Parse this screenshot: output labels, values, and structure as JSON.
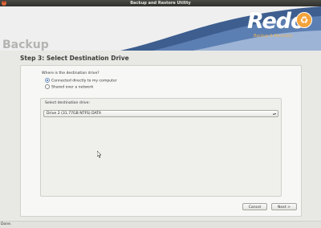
{
  "window": {
    "title": "Backup and Restore Utility"
  },
  "header": {
    "title": "Backup",
    "logo": {
      "name": "Redo",
      "tagline": "Backup & Recovery"
    }
  },
  "step": {
    "title": "Step 3: Select Destination Drive"
  },
  "question": "Where is the destination drive?",
  "options": [
    {
      "label": "Connected directly to my computer",
      "selected": true
    },
    {
      "label": "Shared over a network",
      "selected": false
    }
  ],
  "drive_group": {
    "label": "Select destination drive:",
    "selected": "Drive 2 (31.77GB NTFS) DATA"
  },
  "buttons": {
    "cancel": "Cancel",
    "next": "Next >"
  },
  "status": "Done."
}
